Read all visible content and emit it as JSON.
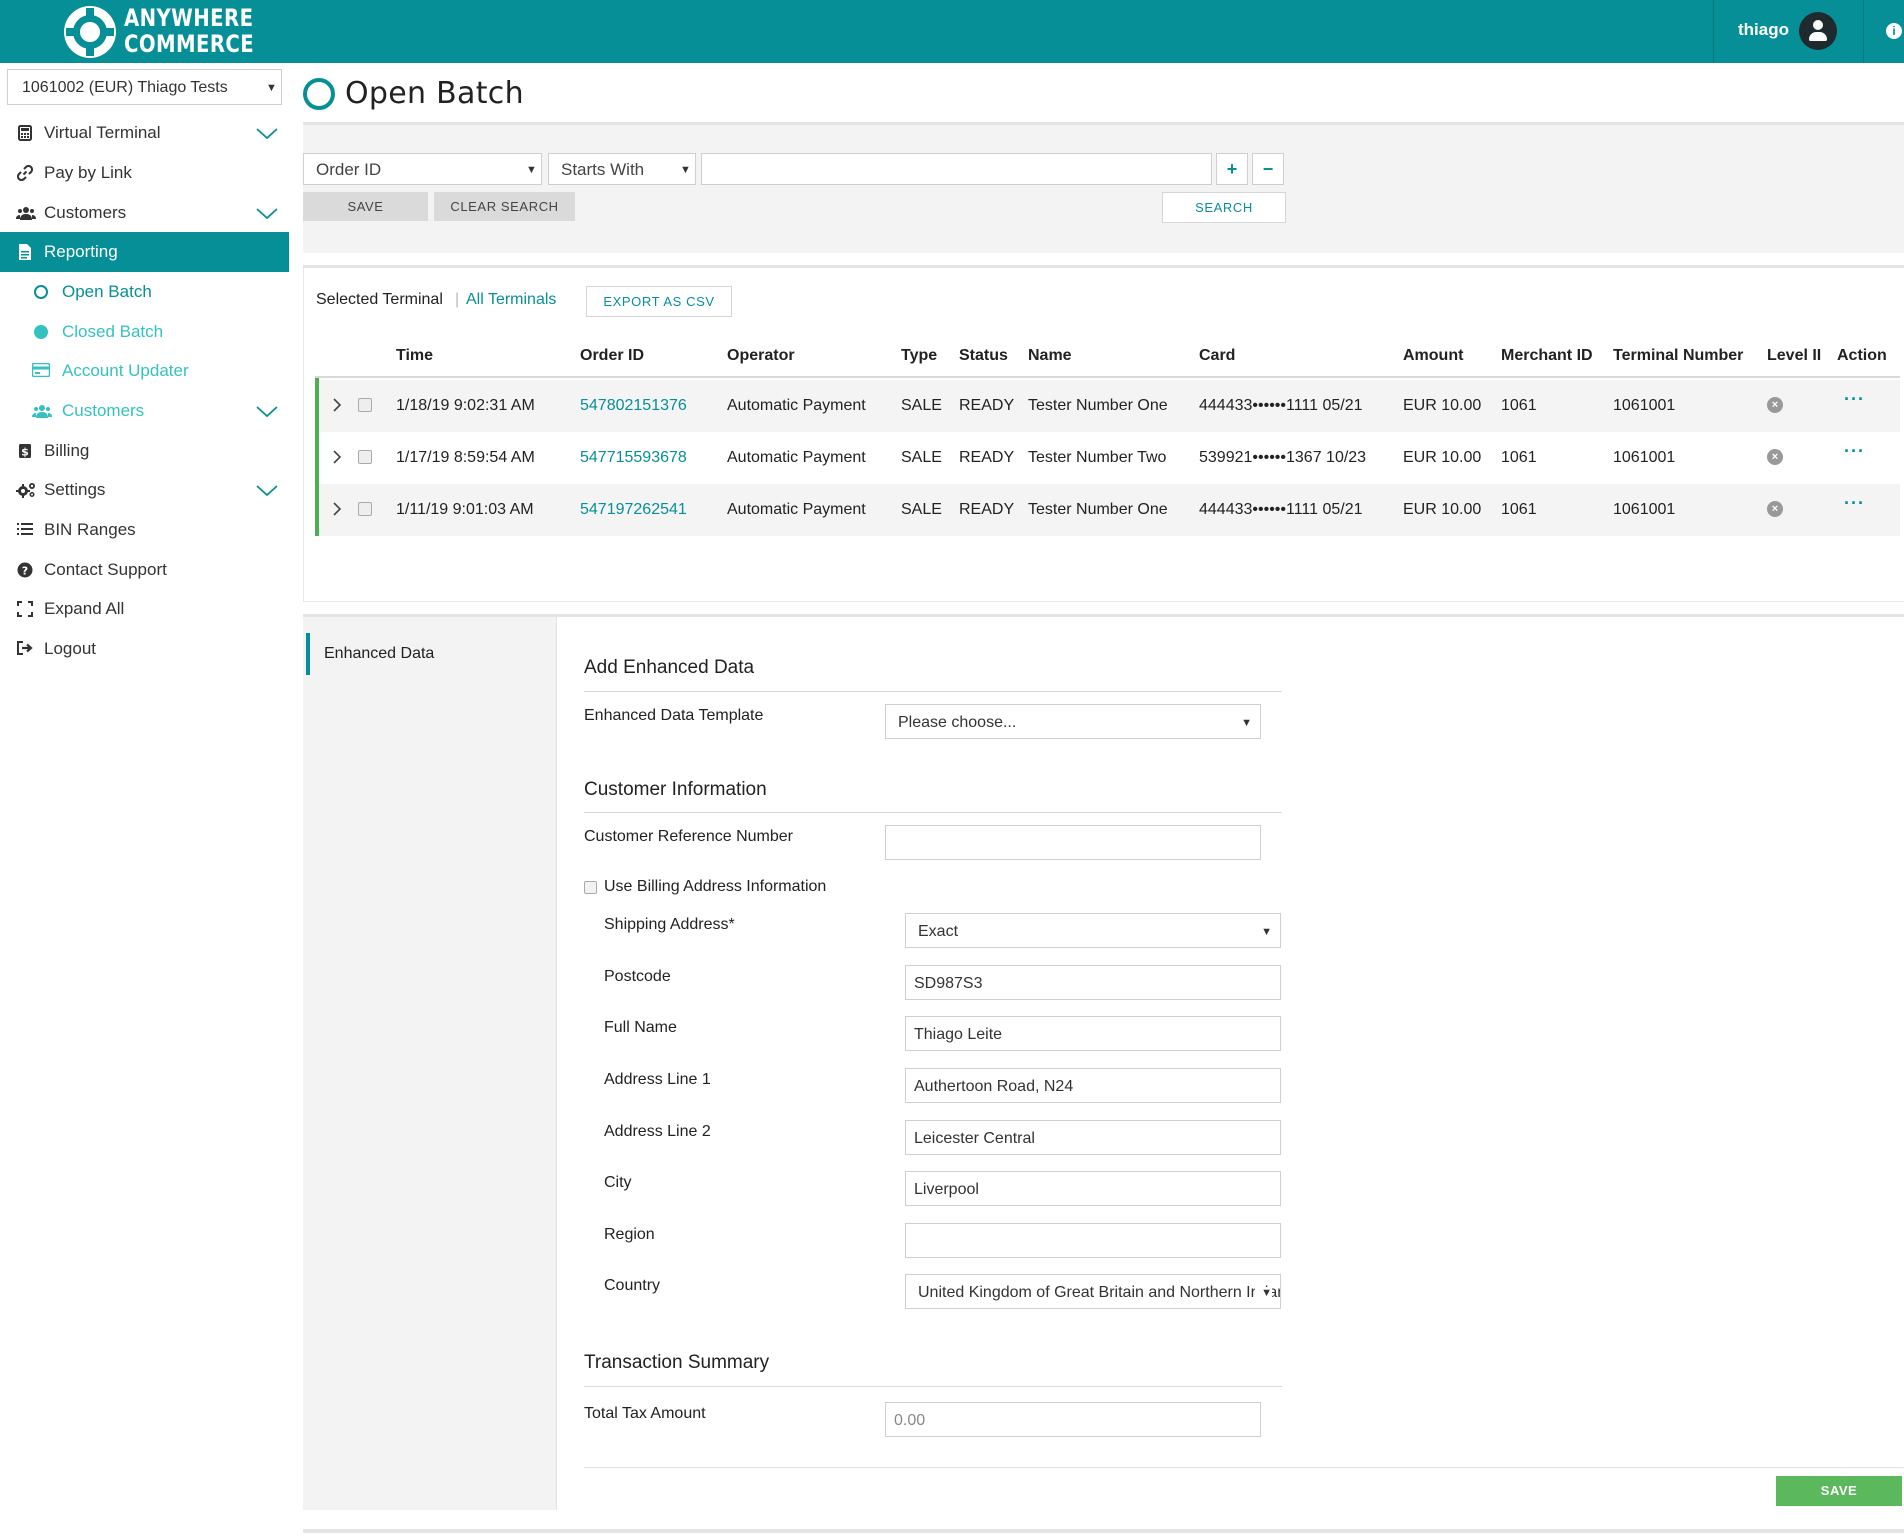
{
  "app": {
    "brand_line1": "ANYWHERE",
    "brand_line2": "COMMERCE",
    "user": "thiago",
    "colors": {
      "primary": "#078f97",
      "accent_light": "#36c1c1",
      "success": "#5bb85d"
    }
  },
  "sidebar": {
    "terminal": "1061002 (EUR) Thiago Tests",
    "items": [
      {
        "label": "Virtual Terminal",
        "icon": "calculator-icon"
      },
      {
        "label": "Pay by Link",
        "icon": "link-icon"
      },
      {
        "label": "Customers",
        "icon": "users-icon"
      },
      {
        "label": "Reporting",
        "icon": "document-icon"
      },
      {
        "label": "Open Batch",
        "icon": "circle-outline-icon"
      },
      {
        "label": "Closed Batch",
        "icon": "circle-filled-icon"
      },
      {
        "label": "Account Updater",
        "icon": "card-icon"
      },
      {
        "label": "Customers",
        "icon": "users-icon"
      },
      {
        "label": "Billing",
        "icon": "dollar-icon"
      },
      {
        "label": "Settings",
        "icon": "gears-icon"
      },
      {
        "label": "BIN Ranges",
        "icon": "list-icon"
      },
      {
        "label": "Contact Support",
        "icon": "question-icon"
      },
      {
        "label": "Expand All",
        "icon": "expand-icon"
      },
      {
        "label": "Logout",
        "icon": "logout-icon"
      }
    ]
  },
  "main": {
    "title": "Open Batch",
    "search": {
      "field": "Order ID",
      "operator": "Starts With",
      "value": "",
      "add": "+",
      "remove": "−",
      "save": "SAVE",
      "clear": "CLEAR SEARCH",
      "search": "SEARCH"
    },
    "filter": {
      "selected": "Selected Terminal",
      "separator": "|",
      "all": "All Terminals",
      "export": "EXPORT AS CSV"
    },
    "table": {
      "headers": [
        "Time",
        "Order ID",
        "Operator",
        "Type",
        "Status",
        "Name",
        "Card",
        "Amount",
        "Merchant ID",
        "Terminal Number",
        "Level II",
        "Action"
      ],
      "rows": [
        {
          "time": "1/18/19 9:02:31 AM",
          "order_id": "547802151376",
          "operator": "Automatic Payment",
          "type": "SALE",
          "status": "READY",
          "name": "Tester Number One",
          "card": "444433••••••1111 05/21",
          "amount": "EUR 10.00",
          "merchant_id": "1061",
          "terminal": "1061001"
        },
        {
          "time": "1/17/19 8:59:54 AM",
          "order_id": "547715593678",
          "operator": "Automatic Payment",
          "type": "SALE",
          "status": "READY",
          "name": "Tester Number Two",
          "card": "539921••••••1367 10/23",
          "amount": "EUR 10.00",
          "merchant_id": "1061",
          "terminal": "1061001"
        },
        {
          "time": "1/11/19 9:01:03 AM",
          "order_id": "547197262541",
          "operator": "Automatic Payment",
          "type": "SALE",
          "status": "READY",
          "name": "Tester Number One",
          "card": "444433••••••1111 05/21",
          "amount": "EUR 10.00",
          "merchant_id": "1061",
          "terminal": "1061001"
        }
      ]
    }
  },
  "enhanced": {
    "tab": "Enhanced Data",
    "add_title": "Add Enhanced Data",
    "template_label": "Enhanced Data Template",
    "template_value": "Please choose...",
    "customer_title": "Customer Information",
    "ref_label": "Customer Reference Number",
    "ref_value": "",
    "billing_label": "Use Billing Address Information",
    "shipping_label": "Shipping Address*",
    "shipping_value": "Exact",
    "postcode_label": "Postcode",
    "postcode_value": "SD987S3",
    "fullname_label": "Full Name",
    "fullname_value": "Thiago Leite",
    "addr1_label": "Address Line 1",
    "addr1_value": "Authertoon Road, N24",
    "addr2_label": "Address Line 2",
    "addr2_value": "Leicester Central",
    "city_label": "City",
    "city_value": "Liverpool",
    "region_label": "Region",
    "region_value": "",
    "country_label": "Country",
    "country_value": "United Kingdom of Great Britain and Northern Ireland",
    "summary_title": "Transaction Summary",
    "tax_label": "Total Tax Amount",
    "tax_value": "0.00",
    "save": "SAVE"
  }
}
